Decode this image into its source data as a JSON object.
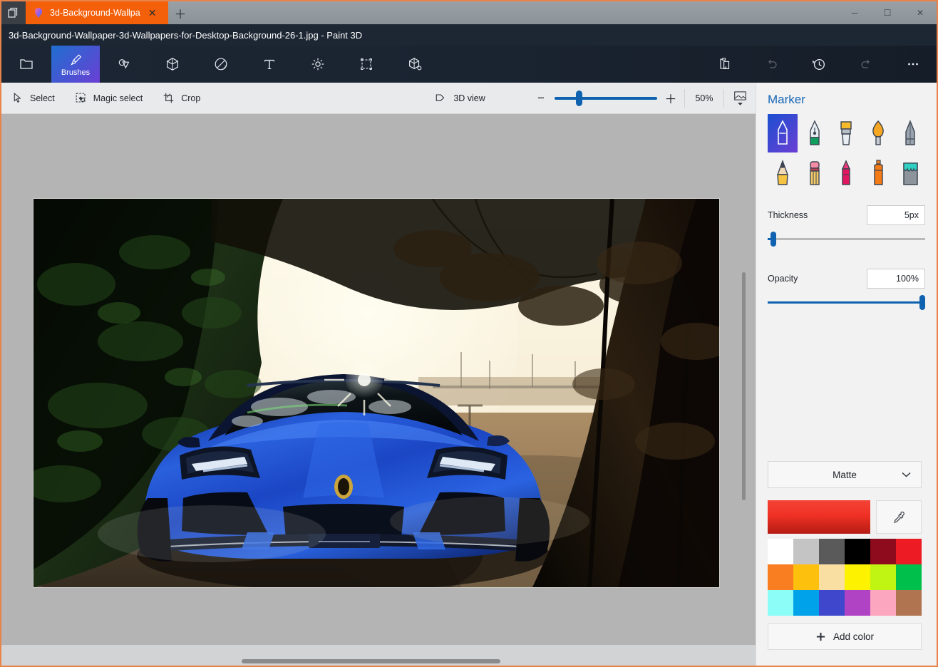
{
  "window": {
    "tab_label": "3d-Background-Wallpa",
    "tab_close": "✕",
    "new_tab": "＋",
    "minimize": "─",
    "maximize": "☐",
    "close": "✕",
    "title": "3d-Background-Wallpaper-3d-Wallpapers-for-Desktop-Background-26-1.jpg - Paint 3D",
    "tab_color": "#f4600a",
    "titlebar_color": "#1d2733",
    "accent_border": "#e8834a"
  },
  "ribbon": {
    "home_label": "Menu",
    "items": [
      {
        "label": "Brushes",
        "icon": "brush-icon",
        "selected": true
      },
      {
        "label": "2D shapes",
        "icon": "2d-shapes-icon",
        "selected": false
      },
      {
        "label": "3D shapes",
        "icon": "3d-shapes-icon",
        "selected": false
      },
      {
        "label": "Stickers",
        "icon": "stickers-icon",
        "selected": false
      },
      {
        "label": "Text",
        "icon": "text-icon",
        "selected": false
      },
      {
        "label": "Effects",
        "icon": "effects-icon",
        "selected": false
      },
      {
        "label": "Canvas",
        "icon": "canvas-icon",
        "selected": false
      },
      {
        "label": "3D library",
        "icon": "3d-library-icon",
        "selected": false
      }
    ],
    "right_items": [
      {
        "label": "Paste",
        "icon": "clipboard-icon",
        "disabled": false
      },
      {
        "label": "Undo",
        "icon": "undo-icon",
        "disabled": true
      },
      {
        "label": "History",
        "icon": "history-icon",
        "disabled": false
      },
      {
        "label": "Redo",
        "icon": "redo-icon",
        "disabled": true
      },
      {
        "label": "More options",
        "icon": "ellipsis-icon",
        "disabled": false
      }
    ]
  },
  "toolbar": {
    "select_label": "Select",
    "magic_select_label": "Magic select",
    "crop_label": "Crop",
    "view3d_label": "3D view",
    "zoom_percent": "50%",
    "zoom_minus": "−",
    "zoom_plus": "＋",
    "zoom_value": 50,
    "fit_label": "Fit to screen"
  },
  "panel": {
    "title": "Marker",
    "brushes": [
      {
        "name": "marker",
        "selected": true
      },
      {
        "name": "calligraphy-pen",
        "selected": false
      },
      {
        "name": "oil-brush",
        "selected": false
      },
      {
        "name": "watercolor",
        "selected": false
      },
      {
        "name": "pixel-pen",
        "selected": false
      },
      {
        "name": "pencil",
        "selected": false
      },
      {
        "name": "eraser",
        "selected": false
      },
      {
        "name": "crayon",
        "selected": false
      },
      {
        "name": "spray-can",
        "selected": false
      },
      {
        "name": "fill",
        "selected": false
      }
    ],
    "thickness_label": "Thickness",
    "thickness_value": "5px",
    "thickness_pct": 5,
    "opacity_label": "Opacity",
    "opacity_value": "100%",
    "opacity_pct": 100,
    "material_label": "Matte",
    "current_color": "#ef3124",
    "eyedropper_label": "Color picker",
    "add_color_label": "Add color",
    "add_color_plus": "＋",
    "swatches": [
      "#ffffff",
      "#c4c4c4",
      "#5a5a5a",
      "#000000",
      "#8e0b1d",
      "#ed1c24",
      "#f97d21",
      "#fcc00d",
      "#f9e0a2",
      "#fdf200",
      "#c0f513",
      "#00bf4a",
      "#8cfdf7",
      "#00a2ea",
      "#3f48cc",
      "#b043c4",
      "#fda6c0",
      "#b07450"
    ]
  },
  "canvas": {
    "background": "#b4b4b4",
    "image_alt": "Blue Lamborghini Aventador on a forest road at sunset",
    "image_width": "962",
    "image_height": "545"
  }
}
